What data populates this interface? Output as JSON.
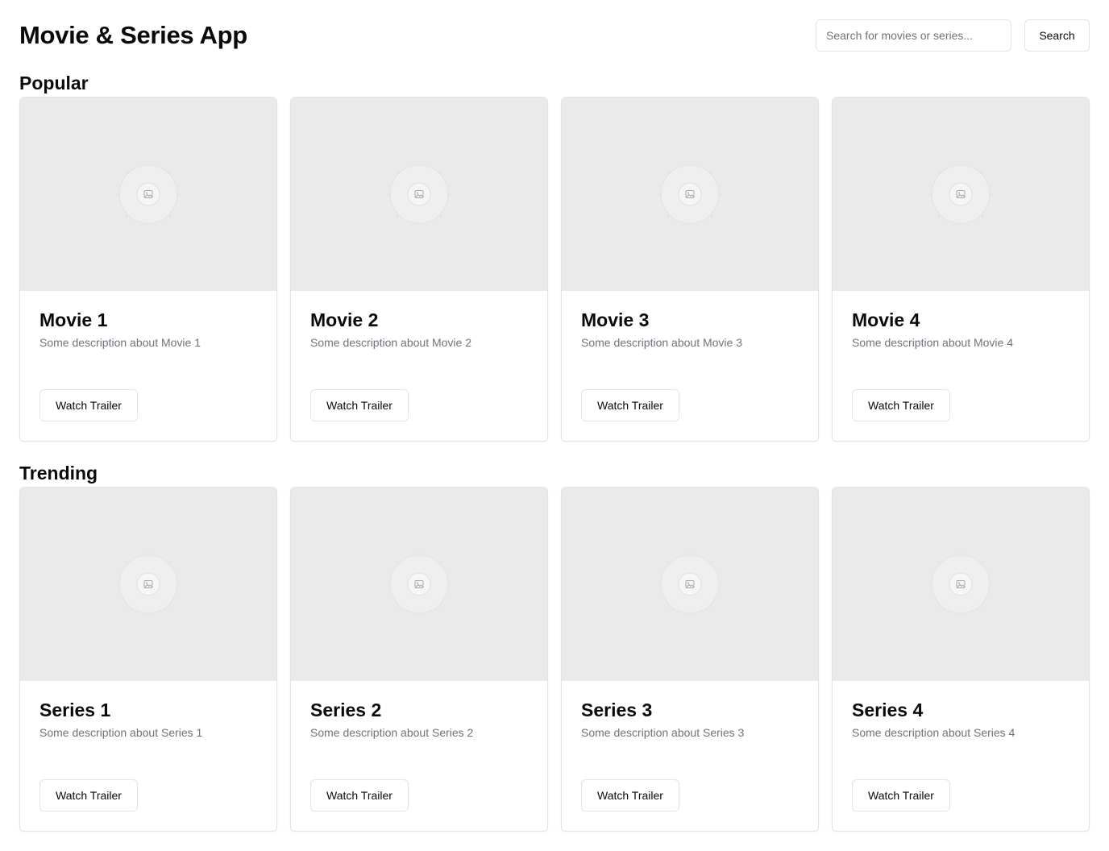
{
  "app": {
    "title": "Movie & Series App"
  },
  "search": {
    "placeholder": "Search for movies or series...",
    "value": "",
    "button_label": "Search"
  },
  "sections": [
    {
      "title": "Popular",
      "cards": [
        {
          "title": "Movie 1",
          "description": "Some description about Movie 1",
          "button_label": "Watch Trailer",
          "image_icon": "image-placeholder-icon"
        },
        {
          "title": "Movie 2",
          "description": "Some description about Movie 2",
          "button_label": "Watch Trailer",
          "image_icon": "image-placeholder-icon"
        },
        {
          "title": "Movie 3",
          "description": "Some description about Movie 3",
          "button_label": "Watch Trailer",
          "image_icon": "image-placeholder-icon"
        },
        {
          "title": "Movie 4",
          "description": "Some description about Movie 4",
          "button_label": "Watch Trailer",
          "image_icon": "image-placeholder-icon"
        }
      ]
    },
    {
      "title": "Trending",
      "cards": [
        {
          "title": "Series 1",
          "description": "Some description about Series 1",
          "button_label": "Watch Trailer",
          "image_icon": "image-placeholder-icon"
        },
        {
          "title": "Series 2",
          "description": "Some description about Series 2",
          "button_label": "Watch Trailer",
          "image_icon": "image-placeholder-icon"
        },
        {
          "title": "Series 3",
          "description": "Some description about Series 3",
          "button_label": "Watch Trailer",
          "image_icon": "image-placeholder-icon"
        },
        {
          "title": "Series 4",
          "description": "Some description about Series 4",
          "button_label": "Watch Trailer",
          "image_icon": "image-placeholder-icon"
        }
      ]
    }
  ]
}
